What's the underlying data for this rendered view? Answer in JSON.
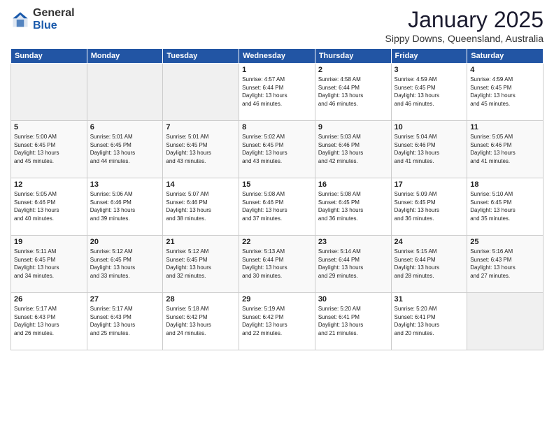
{
  "logo": {
    "general": "General",
    "blue": "Blue"
  },
  "header": {
    "title": "January 2025",
    "subtitle": "Sippy Downs, Queensland, Australia"
  },
  "days_of_week": [
    "Sunday",
    "Monday",
    "Tuesday",
    "Wednesday",
    "Thursday",
    "Friday",
    "Saturday"
  ],
  "weeks": [
    [
      {
        "day": "",
        "info": ""
      },
      {
        "day": "",
        "info": ""
      },
      {
        "day": "",
        "info": ""
      },
      {
        "day": "1",
        "info": "Sunrise: 4:57 AM\nSunset: 6:44 PM\nDaylight: 13 hours\nand 46 minutes."
      },
      {
        "day": "2",
        "info": "Sunrise: 4:58 AM\nSunset: 6:44 PM\nDaylight: 13 hours\nand 46 minutes."
      },
      {
        "day": "3",
        "info": "Sunrise: 4:59 AM\nSunset: 6:45 PM\nDaylight: 13 hours\nand 46 minutes."
      },
      {
        "day": "4",
        "info": "Sunrise: 4:59 AM\nSunset: 6:45 PM\nDaylight: 13 hours\nand 45 minutes."
      }
    ],
    [
      {
        "day": "5",
        "info": "Sunrise: 5:00 AM\nSunset: 6:45 PM\nDaylight: 13 hours\nand 45 minutes."
      },
      {
        "day": "6",
        "info": "Sunrise: 5:01 AM\nSunset: 6:45 PM\nDaylight: 13 hours\nand 44 minutes."
      },
      {
        "day": "7",
        "info": "Sunrise: 5:01 AM\nSunset: 6:45 PM\nDaylight: 13 hours\nand 43 minutes."
      },
      {
        "day": "8",
        "info": "Sunrise: 5:02 AM\nSunset: 6:45 PM\nDaylight: 13 hours\nand 43 minutes."
      },
      {
        "day": "9",
        "info": "Sunrise: 5:03 AM\nSunset: 6:46 PM\nDaylight: 13 hours\nand 42 minutes."
      },
      {
        "day": "10",
        "info": "Sunrise: 5:04 AM\nSunset: 6:46 PM\nDaylight: 13 hours\nand 41 minutes."
      },
      {
        "day": "11",
        "info": "Sunrise: 5:05 AM\nSunset: 6:46 PM\nDaylight: 13 hours\nand 41 minutes."
      }
    ],
    [
      {
        "day": "12",
        "info": "Sunrise: 5:05 AM\nSunset: 6:46 PM\nDaylight: 13 hours\nand 40 minutes."
      },
      {
        "day": "13",
        "info": "Sunrise: 5:06 AM\nSunset: 6:46 PM\nDaylight: 13 hours\nand 39 minutes."
      },
      {
        "day": "14",
        "info": "Sunrise: 5:07 AM\nSunset: 6:46 PM\nDaylight: 13 hours\nand 38 minutes."
      },
      {
        "day": "15",
        "info": "Sunrise: 5:08 AM\nSunset: 6:46 PM\nDaylight: 13 hours\nand 37 minutes."
      },
      {
        "day": "16",
        "info": "Sunrise: 5:08 AM\nSunset: 6:45 PM\nDaylight: 13 hours\nand 36 minutes."
      },
      {
        "day": "17",
        "info": "Sunrise: 5:09 AM\nSunset: 6:45 PM\nDaylight: 13 hours\nand 36 minutes."
      },
      {
        "day": "18",
        "info": "Sunrise: 5:10 AM\nSunset: 6:45 PM\nDaylight: 13 hours\nand 35 minutes."
      }
    ],
    [
      {
        "day": "19",
        "info": "Sunrise: 5:11 AM\nSunset: 6:45 PM\nDaylight: 13 hours\nand 34 minutes."
      },
      {
        "day": "20",
        "info": "Sunrise: 5:12 AM\nSunset: 6:45 PM\nDaylight: 13 hours\nand 33 minutes."
      },
      {
        "day": "21",
        "info": "Sunrise: 5:12 AM\nSunset: 6:45 PM\nDaylight: 13 hours\nand 32 minutes."
      },
      {
        "day": "22",
        "info": "Sunrise: 5:13 AM\nSunset: 6:44 PM\nDaylight: 13 hours\nand 30 minutes."
      },
      {
        "day": "23",
        "info": "Sunrise: 5:14 AM\nSunset: 6:44 PM\nDaylight: 13 hours\nand 29 minutes."
      },
      {
        "day": "24",
        "info": "Sunrise: 5:15 AM\nSunset: 6:44 PM\nDaylight: 13 hours\nand 28 minutes."
      },
      {
        "day": "25",
        "info": "Sunrise: 5:16 AM\nSunset: 6:43 PM\nDaylight: 13 hours\nand 27 minutes."
      }
    ],
    [
      {
        "day": "26",
        "info": "Sunrise: 5:17 AM\nSunset: 6:43 PM\nDaylight: 13 hours\nand 26 minutes."
      },
      {
        "day": "27",
        "info": "Sunrise: 5:17 AM\nSunset: 6:43 PM\nDaylight: 13 hours\nand 25 minutes."
      },
      {
        "day": "28",
        "info": "Sunrise: 5:18 AM\nSunset: 6:42 PM\nDaylight: 13 hours\nand 24 minutes."
      },
      {
        "day": "29",
        "info": "Sunrise: 5:19 AM\nSunset: 6:42 PM\nDaylight: 13 hours\nand 22 minutes."
      },
      {
        "day": "30",
        "info": "Sunrise: 5:20 AM\nSunset: 6:41 PM\nDaylight: 13 hours\nand 21 minutes."
      },
      {
        "day": "31",
        "info": "Sunrise: 5:20 AM\nSunset: 6:41 PM\nDaylight: 13 hours\nand 20 minutes."
      },
      {
        "day": "",
        "info": ""
      }
    ]
  ]
}
